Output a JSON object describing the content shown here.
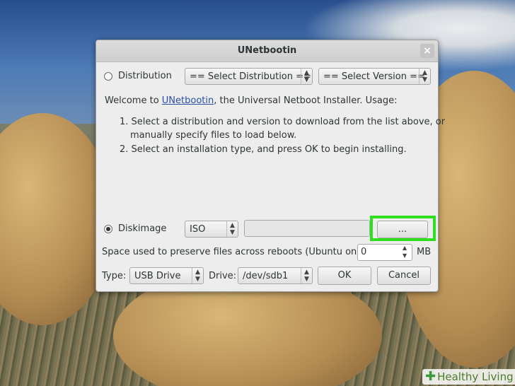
{
  "window": {
    "title": "UNetbootin",
    "close_glyph": "×"
  },
  "distribution": {
    "radio_label": "Distribution",
    "select_distribution": "== Select Distribution ==",
    "select_version": "== Select Version =="
  },
  "intro": {
    "welcome_prefix": "Welcome to ",
    "welcome_link": "UNetbootin",
    "welcome_suffix": ", the Universal Netboot Installer. Usage:",
    "step1_line1": "1. Select a distribution and version to download from the list above, or",
    "step1_line2": "manually specify files to load below.",
    "step2": "2. Select an installation type, and press OK to begin installing."
  },
  "diskimage": {
    "radio_label": "Diskimage",
    "format": "ISO",
    "path_value": "",
    "browse_label": "..."
  },
  "persistence": {
    "label": "Space used to preserve files across reboots (Ubuntu only):",
    "value": "0",
    "unit": "MB"
  },
  "bottom": {
    "type_label": "Type:",
    "type_value": "USB Drive",
    "drive_label": "Drive:",
    "drive_value": "/dev/sdb1",
    "ok_label": "OK",
    "cancel_label": "Cancel"
  },
  "watermark": {
    "text": "Healthy Living"
  },
  "colors": {
    "highlight": "#2ddf1f",
    "link": "#2a4fa2"
  }
}
